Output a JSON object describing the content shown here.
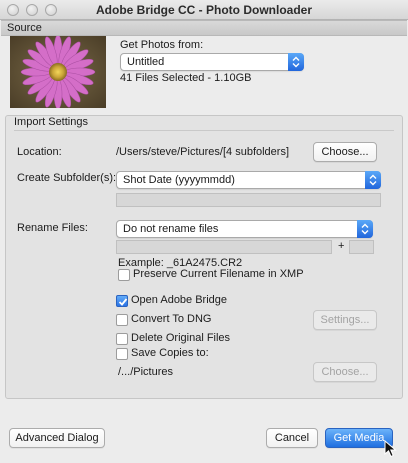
{
  "window": {
    "title": "Adobe Bridge CC - Photo Downloader"
  },
  "source": {
    "heading": "Source",
    "get_photos_label": "Get Photos from:",
    "device_value": "Untitled",
    "files_selected": "41 Files Selected - 1.10GB"
  },
  "import": {
    "heading": "Import Settings",
    "location_label": "Location:",
    "location_path": "/Users/steve/Pictures/[4 subfolders]",
    "choose_label": "Choose...",
    "subfolder_label": "Create Subfolder(s):",
    "subfolder_value": "Shot Date (yyyymmdd)",
    "rename_label": "Rename Files:",
    "rename_value": "Do not rename files",
    "plus": "+",
    "example": "Example:  _61A2475.CR2",
    "preserve_label": "Preserve Current Filename in XMP",
    "preserve_checked": false,
    "open_bridge_label": "Open Adobe Bridge",
    "open_bridge_checked": true,
    "convert_dng_label": "Convert To DNG",
    "convert_dng_checked": false,
    "settings_label": "Settings...",
    "delete_label": "Delete Original Files",
    "delete_checked": false,
    "save_copies_label": "Save Copies to:",
    "save_copies_checked": false,
    "save_path": "/.../Pictures",
    "choose2_label": "Choose..."
  },
  "footer": {
    "advanced_label": "Advanced Dialog",
    "cancel_label": "Cancel",
    "get_media_label": "Get Media"
  },
  "colors": {
    "accent": "#2a73e6",
    "panel": "#e3e3e3",
    "window_bg": "#ececec"
  }
}
